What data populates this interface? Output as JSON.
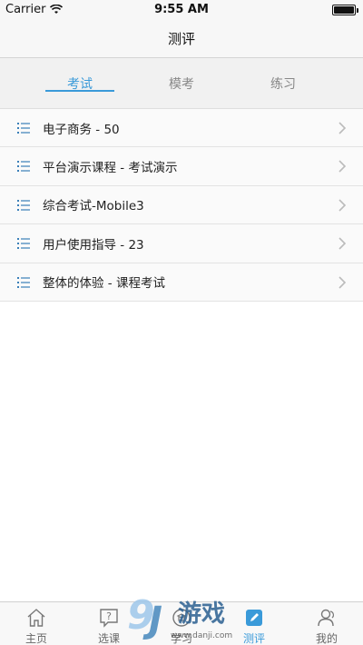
{
  "status_bar": {
    "carrier": "Carrier",
    "time": "9:55 AM"
  },
  "nav": {
    "title": "测评"
  },
  "tabs": [
    {
      "label": "考试",
      "active": true
    },
    {
      "label": "模考",
      "active": false
    },
    {
      "label": "练习",
      "active": false
    }
  ],
  "list": [
    {
      "label": "电子商务 - 50",
      "icon": "list-icon"
    },
    {
      "label": "平台演示课程 - 考试演示",
      "icon": "list-icon"
    },
    {
      "label": "综合考试-Mobile3",
      "icon": "list-icon"
    },
    {
      "label": "用户使用指导 - 23",
      "icon": "list-icon"
    },
    {
      "label": "整体的体验 - 课程考试",
      "icon": "list-icon"
    }
  ],
  "tabbar": [
    {
      "label": "主页",
      "icon": "home-icon"
    },
    {
      "label": "选课",
      "icon": "question-icon"
    },
    {
      "label": "学习",
      "icon": "study-icon"
    },
    {
      "label": "测评",
      "icon": "edit-icon",
      "active": true
    },
    {
      "label": "我的",
      "icon": "user-icon"
    }
  ],
  "watermark": {
    "text": "游戏",
    "url": "www.danji.com"
  },
  "colors": {
    "accent": "#3a9ad9",
    "list_icon": "#3a7fb8"
  }
}
